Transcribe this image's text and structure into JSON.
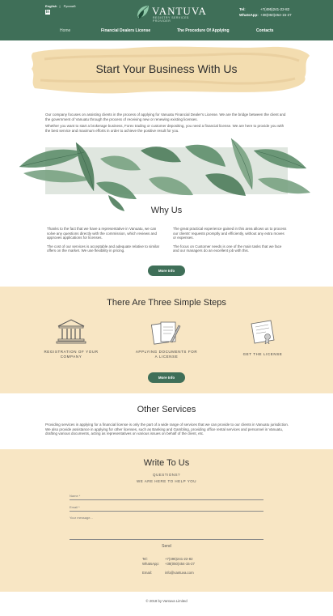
{
  "header": {
    "languages": [
      "English",
      "Русский"
    ],
    "linkedin_icon": "linkedin-icon",
    "logo_name": "VANTUVA",
    "logo_sub": "REGISTRY SERVICES PROVIDER",
    "tel_label": "Tel:",
    "tel_value": "+7(495)241-22-82",
    "whatsapp_label": "WhatsApp:",
    "whatsapp_value": "+38(050)454-15-27",
    "bg_color": "#3f6f58"
  },
  "nav": [
    "Home",
    "Financial Dealers License",
    "The Procedure Of Applying",
    "Contacts"
  ],
  "hero": {
    "title": "Start Your Business With Us"
  },
  "intro": [
    "Our company focuses on assisting clients in the process of applying for Vanuatu Financial Dealer's License. We are the bridge between the client and the government of Vanuatu through the process of receiving new or renewing existing licenses.",
    "Whether you want to start a brokerage business, Forex trading or customer depositing, you need a financial license. We are here to provide you with the best service and maximum efforts in order to achieve the positive result for you."
  ],
  "why": {
    "title": "Why Us",
    "left": [
      "Thanks to the fact that we have a representative in Vanuatu, we can solve any questions directly with the commission, which reviews and approves applications for licenses.",
      "The cost of our services is acceptable and adequate relative to similar offers on the market. We use flexibility in pricing."
    ],
    "right": [
      "The great practical experience gained in this area allows us to process our clients' requests promptly and efficiently, without any extra moves or expenses.",
      "The focus on Customer needs is one of the main tasks that we face and our managers do an excellent job with this."
    ],
    "button": "More Info"
  },
  "steps": {
    "title": "There Are Three Simple Steps",
    "items": [
      {
        "label": "REGISTRATION OF YOUR COMPANY",
        "icon": "bank-building-icon"
      },
      {
        "label": "APPLYING DOCUMENTS FOR A LICENSE",
        "icon": "documents-pen-icon"
      },
      {
        "label": "GET THE LICENSE",
        "icon": "certificate-icon"
      }
    ],
    "button": "More Info",
    "bg_color": "#f8e6c4"
  },
  "other": {
    "title": "Other Services",
    "text": "Providing services in applying for a financial license is only the part of a wide range of services that we can provide to our clients in Vanuatu jurisdiction. We also provide assistance in applying for other licenses, such as Banking and Gambling, providing office rental services and personnel in Vanuatu, drafting various documents, acting as representatives on various issues on behalf of the client, etc."
  },
  "contact": {
    "title": "Write To Us",
    "q1": "QUESTIONS?",
    "q2": "WE ARE HERE TO HELP YOU",
    "name_placeholder": "Name *",
    "email_placeholder": "Email *",
    "message_placeholder": "Your message...",
    "send": "Send",
    "tel_label": "Tel:",
    "tel_value": "+7(495)241-22-82",
    "whatsapp_label": "WhatsApp:",
    "whatsapp_value": "+38(050)454-15-27",
    "email_label": "Email:",
    "email_value": "info@vantuva.com"
  },
  "footer": {
    "copyright": "© 2018 by Vantuva Limited"
  },
  "colors": {
    "accent_green": "#3f6f58",
    "sand": "#f8e6c4"
  }
}
